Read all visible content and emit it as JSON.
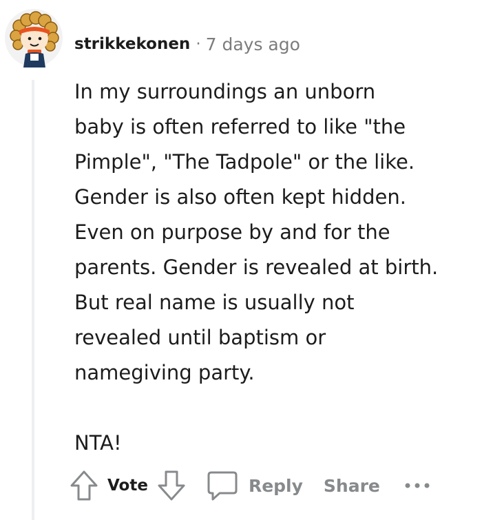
{
  "comment": {
    "username": "strikkekonen",
    "separator": "·",
    "timestamp": "7 days ago",
    "body_lines": [
      "In my surroundings an unborn",
      "baby is often referred to like \"the",
      "Pimple\", \"The Tadpole\" or the like.",
      "Gender is also often kept hidden.",
      "Even on purpose by and for the",
      "parents. Gender is revealed at birth.",
      "But real name is usually not",
      "revealed until baptism or",
      "namegiving party."
    ],
    "body_last": "NTA!"
  },
  "actions": {
    "vote_label": "Vote",
    "reply_label": "Reply",
    "share_label": "Share"
  },
  "icons": {
    "upvote": "arrow-up-icon",
    "downvote": "arrow-down-icon",
    "reply": "speech-bubble-icon",
    "more": "ellipsis-icon"
  },
  "colors": {
    "text": "#1c1c1c",
    "muted": "#878a8c",
    "thread_line": "#edeff1",
    "avatar_background": "#f5f5f5",
    "avatar_accent": "#e8531f"
  }
}
